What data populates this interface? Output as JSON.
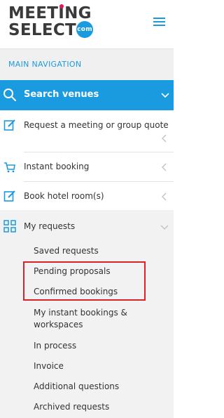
{
  "logo": {
    "line1_pre": "MEET",
    "line1_i": "i",
    "line1_post": "NG",
    "line2": "SELECT",
    "com": "com"
  },
  "nav": {
    "section_label": "MAIN NAVIGATION",
    "search_label": "Search venues",
    "items": [
      {
        "label": "Request a meeting or group quote"
      },
      {
        "label": "Instant booking"
      },
      {
        "label": "Book hotel room(s)"
      },
      {
        "label": "My requests"
      }
    ],
    "sub_items": [
      {
        "label": "Saved requests"
      },
      {
        "label": "Pending proposals"
      },
      {
        "label": "Confirmed bookings"
      },
      {
        "label": "My instant bookings &"
      },
      {
        "label": "workspaces"
      },
      {
        "label": "In process"
      },
      {
        "label": "Invoice"
      },
      {
        "label": "Additional questions"
      },
      {
        "label": "Archived requests"
      }
    ]
  },
  "colors": {
    "brand_blue": "#1a9be0",
    "brand_pink": "#e2145e",
    "highlight_red": "#d8232a"
  }
}
